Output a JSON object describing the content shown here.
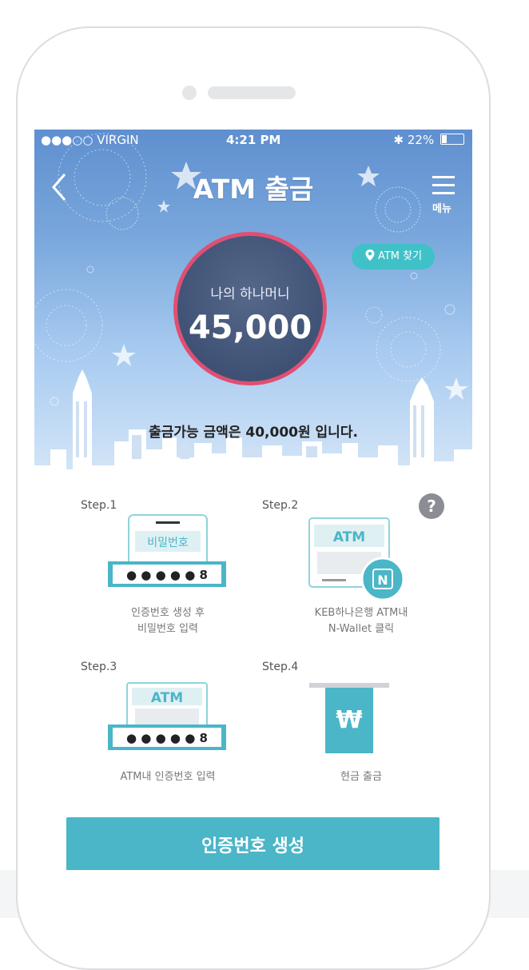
{
  "status_bar": {
    "carrier": "●●●○○ VIRGIN",
    "time": "4:21 PM",
    "battery": "22%"
  },
  "header": {
    "title": "ATM 출금",
    "menu_label": "메뉴",
    "back_icon": "chevron-left-icon",
    "menu_icon": "hamburger-icon"
  },
  "atm_find": {
    "label": "ATM 찾기",
    "icon": "location-pin-icon"
  },
  "balance": {
    "label": "나의 하나머니",
    "amount": "45,000"
  },
  "withdraw_notice": "출금가능 금액은 40,000원 입니다.",
  "help": {
    "label": "?"
  },
  "steps": [
    {
      "label": "Step.1",
      "caption_line1": "인증번호 생성 후",
      "caption_line2": "비밀번호 입력",
      "screen_text": "비밀번호",
      "code": "● ● ● ● ● 8"
    },
    {
      "label": "Step.2",
      "caption_line1": "KEB하나은행 ATM내",
      "caption_line2": "N-Wallet 클릭",
      "screen_text": "ATM",
      "badge": "N"
    },
    {
      "label": "Step.3",
      "caption_line1": "ATM내 인증번호 입력",
      "caption_line2": "",
      "screen_text": "ATM",
      "code": "● ● ● ● ● 8"
    },
    {
      "label": "Step.4",
      "caption_line1": "현금 출금",
      "caption_line2": "",
      "symbol": "₩"
    }
  ],
  "cta": {
    "label": "인증번호 생성"
  },
  "colors": {
    "accent": "#4ab6c8",
    "circle_border": "#e04f72",
    "circle_fill": "#3f5275",
    "sky_top": "#5f8fcf"
  }
}
